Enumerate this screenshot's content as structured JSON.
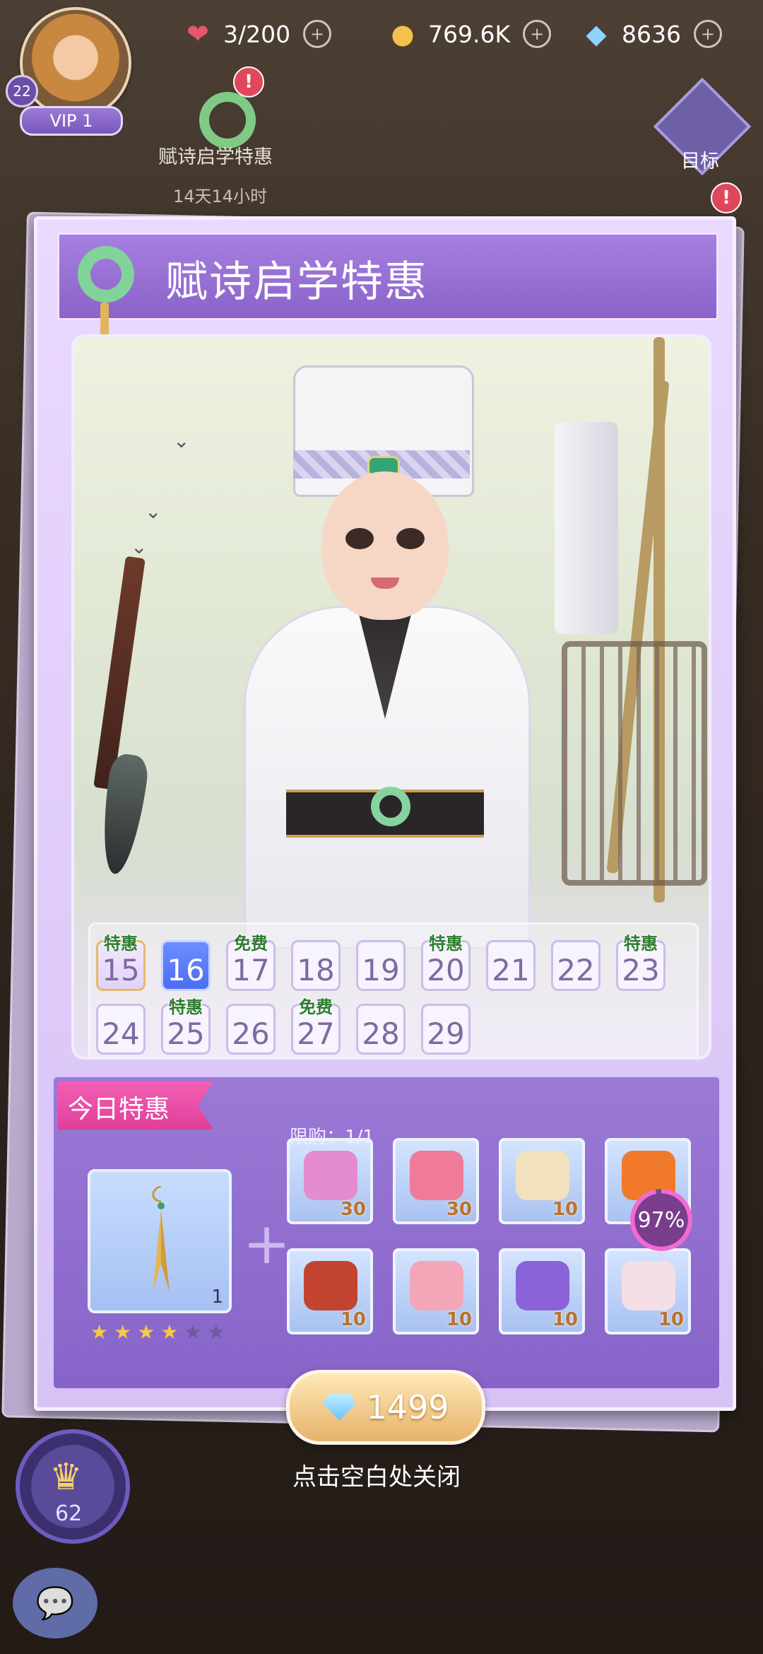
{
  "hud": {
    "player_level": "22",
    "vip": "VIP 1",
    "stamina": "3/200",
    "gold": "769.6K",
    "diamonds": "8636",
    "promo_label": "赋诗启学特惠",
    "promo_timer": "14天14小时",
    "goal_label": "目标"
  },
  "panel": {
    "title": "赋诗启学特惠",
    "calendar": [
      {
        "day": "15",
        "tag": "特惠",
        "state": "past"
      },
      {
        "day": "16",
        "tag": "",
        "state": "today"
      },
      {
        "day": "17",
        "tag": "免费",
        "state": "normal"
      },
      {
        "day": "18",
        "tag": "",
        "state": "normal"
      },
      {
        "day": "19",
        "tag": "",
        "state": "normal"
      },
      {
        "day": "20",
        "tag": "特惠",
        "state": "normal"
      },
      {
        "day": "21",
        "tag": "",
        "state": "normal"
      },
      {
        "day": "22",
        "tag": "",
        "state": "normal"
      },
      {
        "day": "23",
        "tag": "特惠",
        "state": "normal"
      },
      {
        "day": "24",
        "tag": "",
        "state": "normal"
      },
      {
        "day": "25",
        "tag": "特惠",
        "state": "normal"
      },
      {
        "day": "26",
        "tag": "",
        "state": "normal"
      },
      {
        "day": "27",
        "tag": "免费",
        "state": "normal"
      },
      {
        "day": "28",
        "tag": "",
        "state": "normal"
      },
      {
        "day": "29",
        "tag": "",
        "state": "normal"
      }
    ],
    "today_tag": "今日特惠",
    "main_item": {
      "count": "1",
      "stars": 4,
      "max_stars": 6
    },
    "items": [
      {
        "icon": "gift-box-icon",
        "count": "30",
        "color": "#e58bd0"
      },
      {
        "icon": "heart-potion-icon",
        "count": "30",
        "color": "#f07a9a"
      },
      {
        "icon": "silk-ribbon-icon",
        "count": "10",
        "color": "#f2e1bd"
      },
      {
        "icon": "fox-tail-icon",
        "count": "",
        "color": "#f07a2a"
      },
      {
        "icon": "red-leather-icon",
        "count": "10",
        "color": "#c2432f"
      },
      {
        "icon": "pink-fabric-icon",
        "count": "10",
        "color": "#f2a6b8"
      },
      {
        "icon": "purple-feather-icon",
        "count": "10",
        "color": "#8a63d8"
      },
      {
        "icon": "pearl-icon",
        "count": "10",
        "color": "#f4dfe6"
      }
    ],
    "limit": "限购：1/1",
    "discount_progress": "97%",
    "price": "1499",
    "close_hint": "点击空白处关闭"
  },
  "side": {
    "crown_number": "62"
  }
}
